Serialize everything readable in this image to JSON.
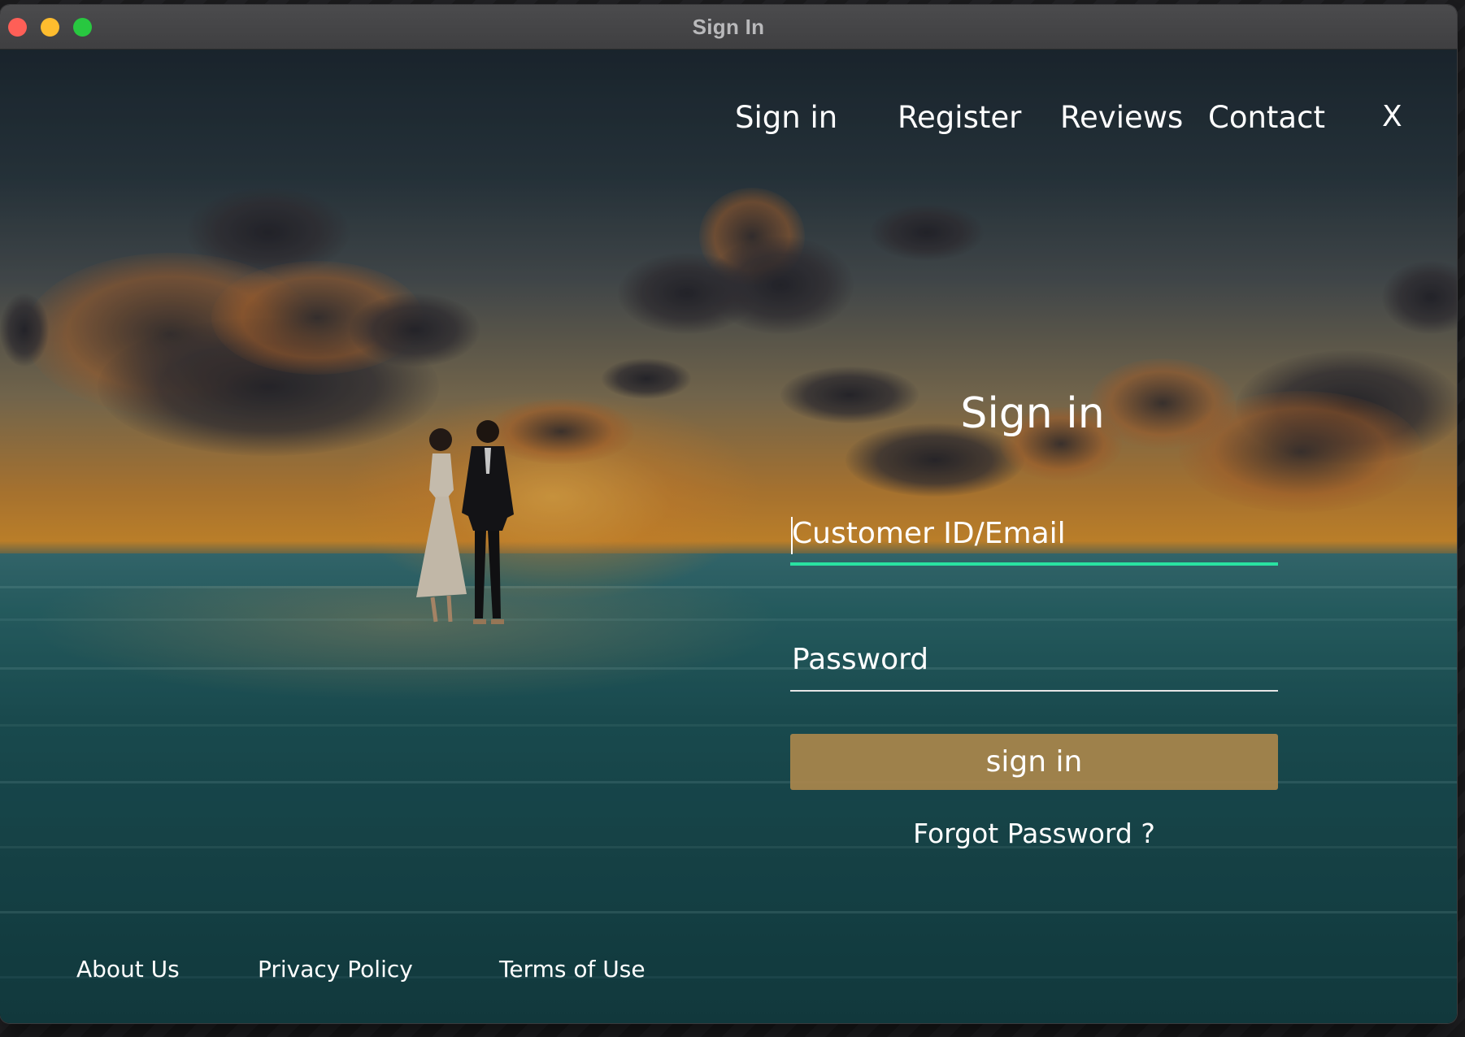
{
  "window": {
    "title": "Sign In"
  },
  "nav": {
    "sign_in": "Sign in",
    "register": "Register",
    "reviews": "Reviews",
    "contact": "Contact",
    "close": "X"
  },
  "form": {
    "title": "Sign in",
    "email_placeholder": "Customer ID/Email",
    "password_placeholder": "Password",
    "submit_label": "sign in",
    "forgot_label": "Forgot Password ?"
  },
  "footer": {
    "about": "About Us",
    "privacy": "Privacy Policy",
    "terms": "Terms of Use"
  },
  "colors": {
    "focus_underline": "#29e2a1",
    "button_bg": "#ad874b",
    "traffic_close": "#fe5f57",
    "traffic_min": "#febc2e",
    "traffic_max": "#28c840"
  }
}
